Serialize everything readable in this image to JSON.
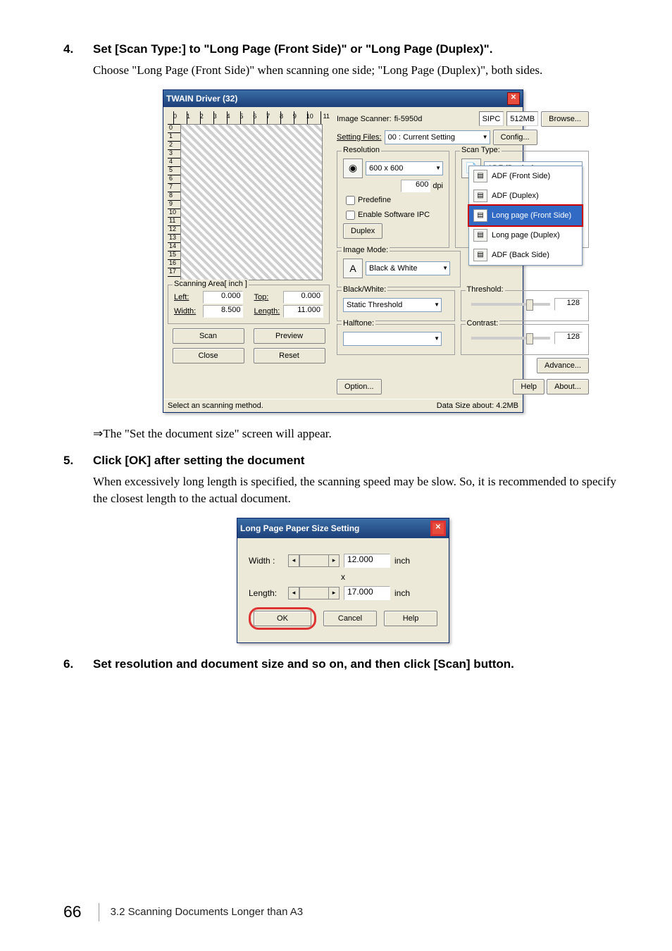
{
  "step4": {
    "num": "4.",
    "title": "Set [Scan Type:] to \"Long Page (Front Side)\" or \"Long Page (Duplex)\".",
    "body": "Choose \"Long Page (Front Side)\" when scanning one side; \"Long Page (Duplex)\", both sides."
  },
  "twain": {
    "title": "TWAIN Driver (32)",
    "ruler_x": [
      "0",
      "1",
      "2",
      "3",
      "4",
      "5",
      "6",
      "7",
      "8",
      "9",
      "10",
      "11"
    ],
    "ruler_y": [
      "0",
      "1",
      "2",
      "3",
      "4",
      "5",
      "6",
      "7",
      "8",
      "9",
      "10",
      "11",
      "12",
      "13",
      "14",
      "15",
      "16",
      "17"
    ],
    "scanArea": {
      "legend": "Scanning Area[ inch ]",
      "leftLabel": "Left:",
      "leftVal": "0.000",
      "topLabel": "Top:",
      "topVal": "0.000",
      "widthLabel": "Width:",
      "widthVal": "8.500",
      "lengthLabel": "Length:",
      "lengthVal": "11.000"
    },
    "buttons": {
      "scan": "Scan",
      "preview": "Preview",
      "close": "Close",
      "reset": "Reset"
    },
    "header": {
      "scannerLabel": "Image Scanner:",
      "scannerVal": "fi-5950d",
      "sipc": "SIPC",
      "mem": "512MB",
      "browse": "Browse...",
      "settingLabel": "Setting Files:",
      "settingVal": "00 : Current Setting",
      "config": "Config..."
    },
    "resolution": {
      "legend": "Resolution",
      "val": "600 x 600",
      "dpiVal": "600",
      "dpiUnit": "dpi",
      "chkPredef": "Predefine",
      "chkIpc": "Enable Software IPC",
      "duplex": "Duplex"
    },
    "scanType": {
      "legend": "Scan Type:",
      "currentOption": "ADF (Duplex)",
      "items": [
        "ADF (Front Side)",
        "ADF (Duplex)",
        "Long page (Front Side)",
        "Long page (Duplex)",
        "ADF (Back Side)"
      ],
      "highlightIndex": 2
    },
    "imageMode": {
      "legend": "Image Mode:",
      "val": "Black & White"
    },
    "bw": {
      "legend": "Black/White:",
      "val": "Static Threshold"
    },
    "halftone": {
      "legend": "Halftone:"
    },
    "threshold": {
      "legend": "Threshold:",
      "val": "128"
    },
    "contrast": {
      "legend": "Contrast:",
      "val": "128"
    },
    "advance": "Advance...",
    "option": "Option...",
    "help": "Help",
    "about": "About...",
    "status": {
      "left": "Select an scanning method.",
      "sizeLabel": "Data Size about:",
      "sizeVal": "4.2MB"
    }
  },
  "afterFig1": "⇒The \"Set the document size\" screen will appear.",
  "step5": {
    "num": "5.",
    "title": "Click [OK] after setting the document",
    "body": "When excessively long length is specified, the scanning speed may be slow. So, it is recommended to specify the closest length to the actual document."
  },
  "longPage": {
    "title": "Long Page Paper Size Setting",
    "widthLabel": "Width :",
    "widthVal": "12.000",
    "xMark": "x",
    "lengthLabel": "Length:",
    "lengthVal": "17.000",
    "unit": "inch",
    "ok": "OK",
    "cancel": "Cancel",
    "help": "Help"
  },
  "step6": {
    "num": "6.",
    "title": "Set resolution and document size and so on, and then click [Scan] button."
  },
  "footer": {
    "page": "66",
    "section": "3.2 Scanning Documents Longer than A3"
  }
}
